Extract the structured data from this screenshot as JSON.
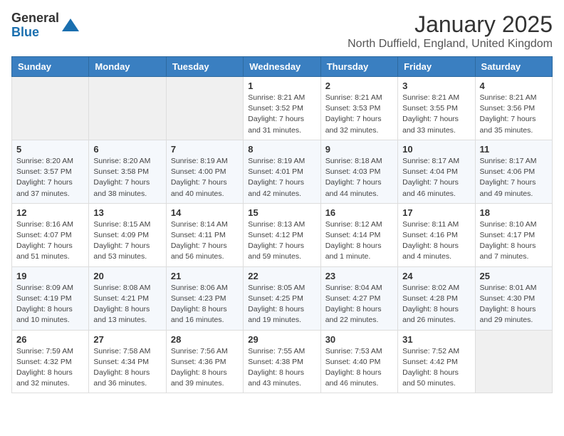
{
  "header": {
    "logo_general": "General",
    "logo_blue": "Blue",
    "title": "January 2025",
    "location": "North Duffield, England, United Kingdom"
  },
  "days_of_week": [
    "Sunday",
    "Monday",
    "Tuesday",
    "Wednesday",
    "Thursday",
    "Friday",
    "Saturday"
  ],
  "weeks": [
    [
      {
        "day": "",
        "sunrise": "",
        "sunset": "",
        "daylight": ""
      },
      {
        "day": "",
        "sunrise": "",
        "sunset": "",
        "daylight": ""
      },
      {
        "day": "",
        "sunrise": "",
        "sunset": "",
        "daylight": ""
      },
      {
        "day": "1",
        "sunrise": "Sunrise: 8:21 AM",
        "sunset": "Sunset: 3:52 PM",
        "daylight": "Daylight: 7 hours and 31 minutes."
      },
      {
        "day": "2",
        "sunrise": "Sunrise: 8:21 AM",
        "sunset": "Sunset: 3:53 PM",
        "daylight": "Daylight: 7 hours and 32 minutes."
      },
      {
        "day": "3",
        "sunrise": "Sunrise: 8:21 AM",
        "sunset": "Sunset: 3:55 PM",
        "daylight": "Daylight: 7 hours and 33 minutes."
      },
      {
        "day": "4",
        "sunrise": "Sunrise: 8:21 AM",
        "sunset": "Sunset: 3:56 PM",
        "daylight": "Daylight: 7 hours and 35 minutes."
      }
    ],
    [
      {
        "day": "5",
        "sunrise": "Sunrise: 8:20 AM",
        "sunset": "Sunset: 3:57 PM",
        "daylight": "Daylight: 7 hours and 37 minutes."
      },
      {
        "day": "6",
        "sunrise": "Sunrise: 8:20 AM",
        "sunset": "Sunset: 3:58 PM",
        "daylight": "Daylight: 7 hours and 38 minutes."
      },
      {
        "day": "7",
        "sunrise": "Sunrise: 8:19 AM",
        "sunset": "Sunset: 4:00 PM",
        "daylight": "Daylight: 7 hours and 40 minutes."
      },
      {
        "day": "8",
        "sunrise": "Sunrise: 8:19 AM",
        "sunset": "Sunset: 4:01 PM",
        "daylight": "Daylight: 7 hours and 42 minutes."
      },
      {
        "day": "9",
        "sunrise": "Sunrise: 8:18 AM",
        "sunset": "Sunset: 4:03 PM",
        "daylight": "Daylight: 7 hours and 44 minutes."
      },
      {
        "day": "10",
        "sunrise": "Sunrise: 8:17 AM",
        "sunset": "Sunset: 4:04 PM",
        "daylight": "Daylight: 7 hours and 46 minutes."
      },
      {
        "day": "11",
        "sunrise": "Sunrise: 8:17 AM",
        "sunset": "Sunset: 4:06 PM",
        "daylight": "Daylight: 7 hours and 49 minutes."
      }
    ],
    [
      {
        "day": "12",
        "sunrise": "Sunrise: 8:16 AM",
        "sunset": "Sunset: 4:07 PM",
        "daylight": "Daylight: 7 hours and 51 minutes."
      },
      {
        "day": "13",
        "sunrise": "Sunrise: 8:15 AM",
        "sunset": "Sunset: 4:09 PM",
        "daylight": "Daylight: 7 hours and 53 minutes."
      },
      {
        "day": "14",
        "sunrise": "Sunrise: 8:14 AM",
        "sunset": "Sunset: 4:11 PM",
        "daylight": "Daylight: 7 hours and 56 minutes."
      },
      {
        "day": "15",
        "sunrise": "Sunrise: 8:13 AM",
        "sunset": "Sunset: 4:12 PM",
        "daylight": "Daylight: 7 hours and 59 minutes."
      },
      {
        "day": "16",
        "sunrise": "Sunrise: 8:12 AM",
        "sunset": "Sunset: 4:14 PM",
        "daylight": "Daylight: 8 hours and 1 minute."
      },
      {
        "day": "17",
        "sunrise": "Sunrise: 8:11 AM",
        "sunset": "Sunset: 4:16 PM",
        "daylight": "Daylight: 8 hours and 4 minutes."
      },
      {
        "day": "18",
        "sunrise": "Sunrise: 8:10 AM",
        "sunset": "Sunset: 4:17 PM",
        "daylight": "Daylight: 8 hours and 7 minutes."
      }
    ],
    [
      {
        "day": "19",
        "sunrise": "Sunrise: 8:09 AM",
        "sunset": "Sunset: 4:19 PM",
        "daylight": "Daylight: 8 hours and 10 minutes."
      },
      {
        "day": "20",
        "sunrise": "Sunrise: 8:08 AM",
        "sunset": "Sunset: 4:21 PM",
        "daylight": "Daylight: 8 hours and 13 minutes."
      },
      {
        "day": "21",
        "sunrise": "Sunrise: 8:06 AM",
        "sunset": "Sunset: 4:23 PM",
        "daylight": "Daylight: 8 hours and 16 minutes."
      },
      {
        "day": "22",
        "sunrise": "Sunrise: 8:05 AM",
        "sunset": "Sunset: 4:25 PM",
        "daylight": "Daylight: 8 hours and 19 minutes."
      },
      {
        "day": "23",
        "sunrise": "Sunrise: 8:04 AM",
        "sunset": "Sunset: 4:27 PM",
        "daylight": "Daylight: 8 hours and 22 minutes."
      },
      {
        "day": "24",
        "sunrise": "Sunrise: 8:02 AM",
        "sunset": "Sunset: 4:28 PM",
        "daylight": "Daylight: 8 hours and 26 minutes."
      },
      {
        "day": "25",
        "sunrise": "Sunrise: 8:01 AM",
        "sunset": "Sunset: 4:30 PM",
        "daylight": "Daylight: 8 hours and 29 minutes."
      }
    ],
    [
      {
        "day": "26",
        "sunrise": "Sunrise: 7:59 AM",
        "sunset": "Sunset: 4:32 PM",
        "daylight": "Daylight: 8 hours and 32 minutes."
      },
      {
        "day": "27",
        "sunrise": "Sunrise: 7:58 AM",
        "sunset": "Sunset: 4:34 PM",
        "daylight": "Daylight: 8 hours and 36 minutes."
      },
      {
        "day": "28",
        "sunrise": "Sunrise: 7:56 AM",
        "sunset": "Sunset: 4:36 PM",
        "daylight": "Daylight: 8 hours and 39 minutes."
      },
      {
        "day": "29",
        "sunrise": "Sunrise: 7:55 AM",
        "sunset": "Sunset: 4:38 PM",
        "daylight": "Daylight: 8 hours and 43 minutes."
      },
      {
        "day": "30",
        "sunrise": "Sunrise: 7:53 AM",
        "sunset": "Sunset: 4:40 PM",
        "daylight": "Daylight: 8 hours and 46 minutes."
      },
      {
        "day": "31",
        "sunrise": "Sunrise: 7:52 AM",
        "sunset": "Sunset: 4:42 PM",
        "daylight": "Daylight: 8 hours and 50 minutes."
      },
      {
        "day": "",
        "sunrise": "",
        "sunset": "",
        "daylight": ""
      }
    ]
  ]
}
